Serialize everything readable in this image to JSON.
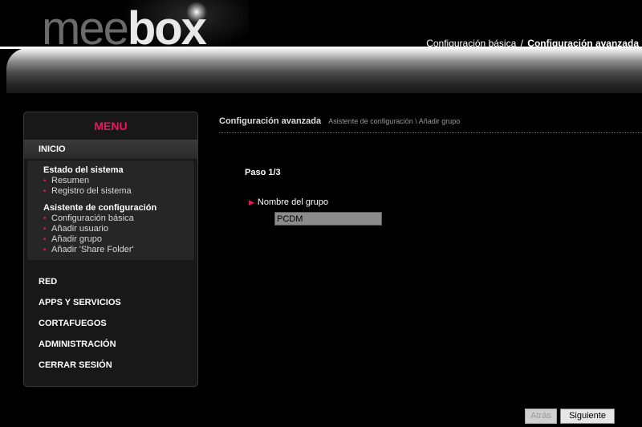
{
  "header": {
    "logo_part1": "mee",
    "logo_part2": "box",
    "link_basic": "Configuración básica",
    "link_sep": "/",
    "link_advanced": "Configuración avanzada"
  },
  "sidebar": {
    "title": "MENU",
    "inicio": "INICIO",
    "estado_head": "Estado del sistema",
    "estado_items": [
      "Resumen",
      "Registro del sistema"
    ],
    "asistente_head": "Asistente de configuración",
    "asistente_items": [
      "Configuración básica",
      "Añadir usuario",
      "Añadir grupo",
      "Añadir 'Share Folder'"
    ],
    "nav": [
      "RED",
      "APPS Y SERVICIOS",
      "CORTAFUEGOS",
      "ADMINISTRACIÓN",
      "CERRAR SESIÓN"
    ]
  },
  "main": {
    "section_title": "Configuración avanzada",
    "path": "Asistente de configuración \\ Añadir grupo",
    "step": "Paso 1/3",
    "field_label": "Nombre del grupo",
    "field_value": "PCDM"
  },
  "buttons": {
    "back": "Atrás",
    "next": "Siguiente"
  },
  "colors": {
    "accent": "#e8185e"
  }
}
